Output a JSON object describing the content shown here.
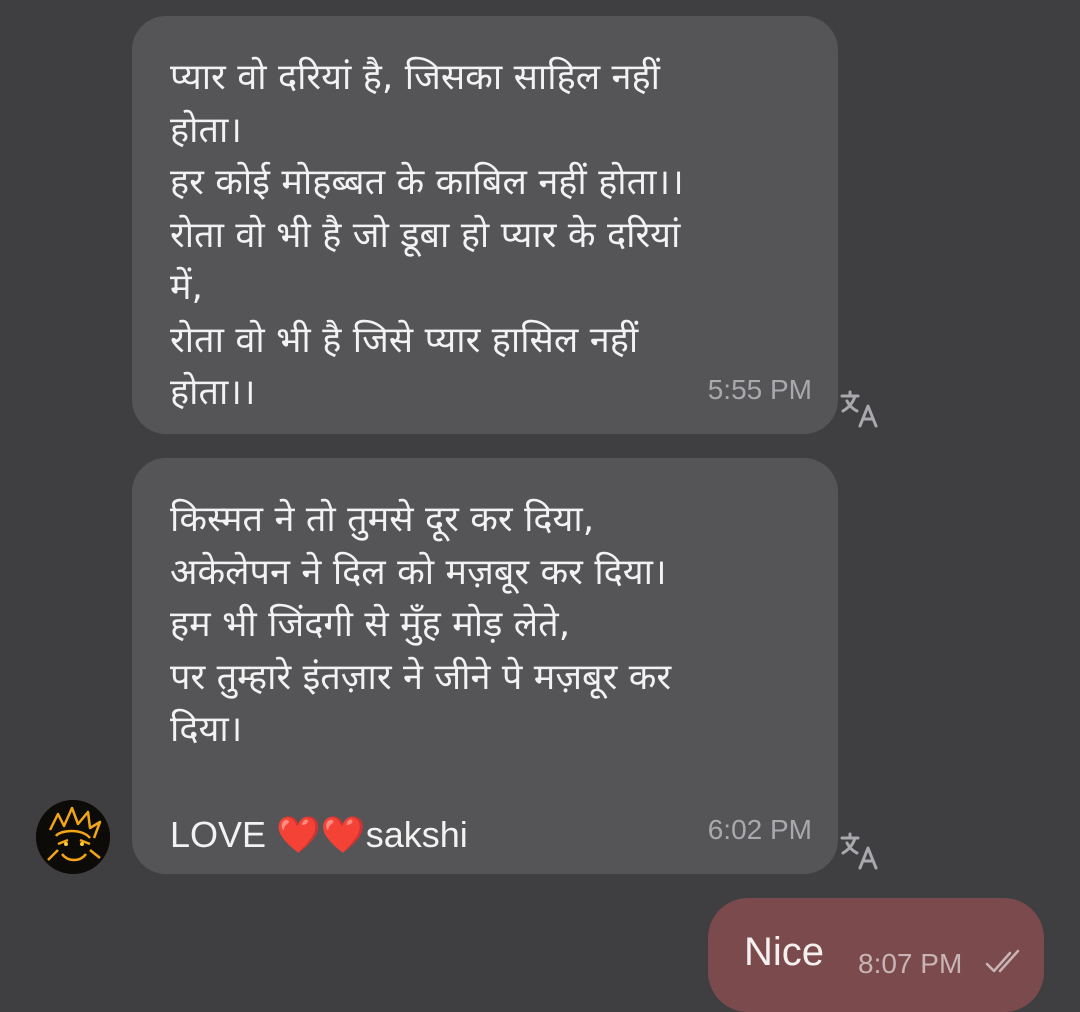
{
  "messages": [
    {
      "lines": [
        "प्यार वो दरियां है, जिसका साहिल नहीं",
        "होता।",
        "हर कोई मोहब्बत के काबिल नहीं होता।।",
        "रोता वो भी है जो डूबा हो प्यार के दरियां",
        "में,",
        "रोता वो भी है जिसे प्यार हासिल नहीं",
        "होता।।"
      ],
      "time": "5:55 PM",
      "translate_icon": "translate-icon"
    },
    {
      "lines": [
        "किस्मत ने तो तुमसे दूर कर दिया,",
        "अकेलेपन ने दिल को मज़बूर कर दिया।",
        "हम भी जिंदगी से मुँह मोड़ लेते,",
        "पर तुम्हारे इंतज़ार ने जीने पे मज़बूर कर",
        "दिया।",
        ""
      ],
      "last_line": {
        "prefix": "LOVE ",
        "hearts": "❤️❤️",
        "suffix": "sakshi"
      },
      "time": "6:02 PM",
      "translate_icon": "translate-icon"
    }
  ],
  "outgoing": {
    "text": "Nice",
    "time": "8:07 PM",
    "status_icon": "double-check-icon"
  },
  "colors": {
    "background": "#3f3f42",
    "incoming_bubble": "#555558",
    "outgoing_bubble": "#7a4a4c",
    "heart": "#e0262f"
  }
}
